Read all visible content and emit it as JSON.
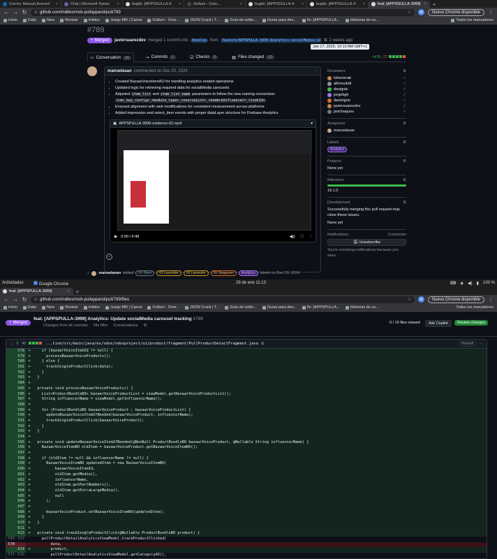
{
  "window1": {
    "tabs": [
      {
        "title": "Correo: Manuel.Aceved"
      },
      {
        "title": "Chat | Microsoft Teams"
      },
      {
        "title": "bugfix: [APPSSULLA-4"
      },
      {
        "title": "Gollum - Over..."
      },
      {
        "title": "bugfix: [APPSSULLA-4"
      },
      {
        "title": "bugfix: [APPSSULLA-4"
      },
      {
        "title": "feat: [APPSSULLA-3999]",
        "active": true
      }
    ],
    "url": "github.com/inditex/mob-pullappand/pull/789",
    "update_label": "Nuevo Chrome disponible",
    "profile_initial": "M"
  },
  "bookmarks": [
    {
      "label": "Inicio"
    },
    {
      "label": "Daily"
    },
    {
      "label": "New"
    },
    {
      "label": "Revisar"
    },
    {
      "label": "Inditex"
    },
    {
      "label": "Juego MR | Canva"
    },
    {
      "label": "Gollum - Over..."
    },
    {
      "label": "JSON Crack | T..."
    },
    {
      "label": "Guía de estilo..."
    },
    {
      "label": "Guías para des..."
    },
    {
      "label": "fix: [APPSPULLA..."
    },
    {
      "label": "Historias de us..."
    }
  ],
  "bookmarks_all": "Todos los marcadores",
  "pr": {
    "number": "#789",
    "status": "Merged",
    "author": "javiersuarezdev",
    "merged_text": "merged 1 commit into",
    "base_branch": "develop",
    "from_text": "from",
    "head_branch": "feature/APPSPULLA-3999-Analytics-socialMedia-v2",
    "time_ago": "2 weeks ago",
    "tooltip": "Jan 17, 2025, 10:10 AM GMT+1",
    "tabs": [
      {
        "label": "Conversation",
        "count": "24"
      },
      {
        "label": "Commits",
        "count": "1"
      },
      {
        "label": "Checks",
        "count": "6"
      },
      {
        "label": "Files changed",
        "count": "15"
      }
    ],
    "additions": "+478",
    "deletions": "-27"
  },
  "comment": {
    "author": "manuelasan",
    "action": "commented on Dec 20, 2024",
    "items": [
      "Created BazaarVoiceItemAO for handling analytics-related operations",
      "Updated logic for retrieving required data for socialMedia carousels",
      "Ensured alignment with web modifications for consistent measurement across platforms",
      "Added impression and select_item events with proper dataLayer structure for Firebase Analytics"
    ],
    "adjusted_pre": "Adjusted",
    "code1": "item_list",
    "and": "and",
    "code2": "item_list_name",
    "adjusted_post": "parameters to follow the new naming convention:",
    "code3": "<cms_key_config>_<module_type>_<sourceList>_<nombreInfluencer>_<lookId>",
    "video_name": "APPSPULLA-3999-evidence-02.mp4",
    "video_time": "0:00 / 0:48"
  },
  "label_event": {
    "author": "manuelasan",
    "added": "added",
    "labels": [
      {
        "name": "01 Stent",
        "color": "#6e7681"
      },
      {
        "name": "02 Lavender",
        "color": "#d29922"
      },
      {
        "name": "02 Lavender",
        "color": "#d29922"
      },
      {
        "name": "01 Targaryen",
        "color": "#db6d28"
      },
      {
        "name": "Analytics",
        "color": "#a371f7"
      }
    ],
    "suffix": "labels on Dec 20, 2024"
  },
  "sidebar": {
    "reviewers_title": "Reviewers",
    "reviewers": [
      "fvherrerab",
      "alfonsobdl",
      "davigoie",
      "jorgebgh",
      "danielgrio",
      "javiersuarezdev",
      "javichaques"
    ],
    "assignees_title": "Assignees",
    "assignee": "manuelasan",
    "labels_title": "Labels",
    "label": "Analytics",
    "projects_title": "Projects",
    "projects_value": "None yet",
    "milestone_title": "Milestone",
    "milestone_value": "19.1.0",
    "development_title": "Development",
    "development_text": "Successfully merging this pull request may close these issues.",
    "development_value": "None yet",
    "notifications_title": "Notifications",
    "customize": "Customize",
    "unsubscribe": "Unsubscribe",
    "notif_text": "You're receiving notifications because you were"
  },
  "system_bar": {
    "activities": "Actividades",
    "app": "Google Chrome",
    "datetime": "29 de ene  11:13",
    "battery": "100 %"
  },
  "window2": {
    "tab_title": "feat: [APPSPULLA-3999]",
    "url": "github.com/inditex/mob-pullappand/pull/789/files",
    "update_label": "Nuevo Chrome disponible",
    "profile_initial": "M"
  },
  "files_view": {
    "status": "Merged",
    "title": "feat: [APPSPULLA-3999] Analytics: Update socialMedia carousel tracking",
    "number": "#789",
    "changes_from": "Changes from all commits",
    "file_filter": "File filter",
    "conversations": "Conversations",
    "files_viewed": "0 / 15 files viewed",
    "ask_copilot": "Ask Copilot",
    "review_changes": "Review changes",
    "file_changes": "48",
    "file_path": "...tion/src/main/java/es/sdos/sdosproject/ui/product/fragment/PullProductDetailFragment.java",
    "viewed": "Viewed"
  },
  "diff": [
    {
      "t": "add",
      "o": "",
      "n": "578",
      "c": "    if (bazaarVoiceItemId != null) {"
    },
    {
      "t": "add",
      "o": "",
      "n": "579",
      "c": "      processBazaarVoiceProducts();"
    },
    {
      "t": "add",
      "o": "",
      "n": "580",
      "c": "    } else {"
    },
    {
      "t": "add",
      "o": "",
      "n": "581",
      "c": "      trackSingleProductClick(data);"
    },
    {
      "t": "add",
      "o": "",
      "n": "582",
      "c": "    }"
    },
    {
      "t": "add",
      "o": "",
      "n": "583",
      "c": "  }"
    },
    {
      "t": "add",
      "o": "",
      "n": "584",
      "c": ""
    },
    {
      "t": "add",
      "o": "",
      "n": "585",
      "c": "  private void processBazaarVoiceProducts() {"
    },
    {
      "t": "add",
      "o": "",
      "n": "586",
      "c": "    List<ProductBundleBO> bazaarVoiceProductList = viewModel.getBazaarVoiceProductList();"
    },
    {
      "t": "add",
      "o": "",
      "n": "587",
      "c": "    String influencerName = viewModel.getInfluencerName();"
    },
    {
      "t": "add",
      "o": "",
      "n": "588",
      "c": ""
    },
    {
      "t": "add",
      "o": "",
      "n": "589",
      "c": "    for (ProductBundleBO bazaarVoiceProduct : bazaarVoiceProductList) {"
    },
    {
      "t": "add",
      "o": "",
      "n": "590",
      "c": "      updateBazaarVoiceItemIfNeeded(bazaarVoiceProduct, influencerName);"
    },
    {
      "t": "add",
      "o": "",
      "n": "591",
      "c": "      trackSingleProductClick(bazaarVoiceProduct);"
    },
    {
      "t": "add",
      "o": "",
      "n": "592",
      "c": "    }"
    },
    {
      "t": "add",
      "o": "",
      "n": "593",
      "c": "  }"
    },
    {
      "t": "add",
      "o": "",
      "n": "594",
      "c": ""
    },
    {
      "t": "add",
      "o": "",
      "n": "595",
      "c": "  private void updateBazaarVoiceItemIfNeeded(@NonNull ProductBundleBO bazaarVoiceProduct, @Nullable String influencerName) {"
    },
    {
      "t": "add",
      "o": "",
      "n": "596",
      "c": "    BazaarVoiceItemBO oldItem = bazaarVoiceProduct.getBazaarVoiceItemBO();"
    },
    {
      "t": "add",
      "o": "",
      "n": "597",
      "c": ""
    },
    {
      "t": "add",
      "o": "",
      "n": "598",
      "c": "    if (oldItem != null && influencerName != null) {"
    },
    {
      "t": "add",
      "o": "",
      "n": "599",
      "c": "      BazaarVoiceItemBO updatedItem = new BazaarVoiceItemBO("
    },
    {
      "t": "add",
      "o": "",
      "n": "600",
      "c": "          bazaarVoiceItemId,"
    },
    {
      "t": "add",
      "o": "",
      "n": "601",
      "c": "          oldItem.getMedia(),"
    },
    {
      "t": "add",
      "o": "",
      "n": "602",
      "c": "          influencerName,"
    },
    {
      "t": "add",
      "o": "",
      "n": "603",
      "c": "          oldItem.getPartNumbers(),"
    },
    {
      "t": "add",
      "o": "",
      "n": "604",
      "c": "          oldItem.getExtraLargeMedia(),"
    },
    {
      "t": "add",
      "o": "",
      "n": "605",
      "c": "          null"
    },
    {
      "t": "add",
      "o": "",
      "n": "606",
      "c": "      );"
    },
    {
      "t": "add",
      "o": "",
      "n": "607",
      "c": ""
    },
    {
      "t": "add",
      "o": "",
      "n": "608",
      "c": "      bazaarVoiceProduct.setBazaarVoiceItemBO(updatedItem);"
    },
    {
      "t": "add",
      "o": "",
      "n": "609",
      "c": "    }"
    },
    {
      "t": "add",
      "o": "",
      "n": "610",
      "c": "  }"
    },
    {
      "t": "add",
      "o": "",
      "n": "611",
      "c": ""
    },
    {
      "t": "add",
      "o": "",
      "n": "612",
      "c": "  private void trackSingleProductClick(@Nullable ProductBundleBO product) {"
    },
    {
      "t": "ctx",
      "o": "569",
      "n": "613",
      "c": "    pullProductDetailAnalyticsViewModel.trackProductClicked("
    },
    {
      "t": "rem",
      "o": "570",
      "n": "",
      "c": "        data,"
    },
    {
      "t": "add",
      "o": "",
      "n": "614",
      "c": "        product,"
    },
    {
      "t": "ctx",
      "o": "571",
      "n": "615",
      "c": "        pullProductDetailAnalyticsViewModel.getCategoryAO(),"
    }
  ]
}
